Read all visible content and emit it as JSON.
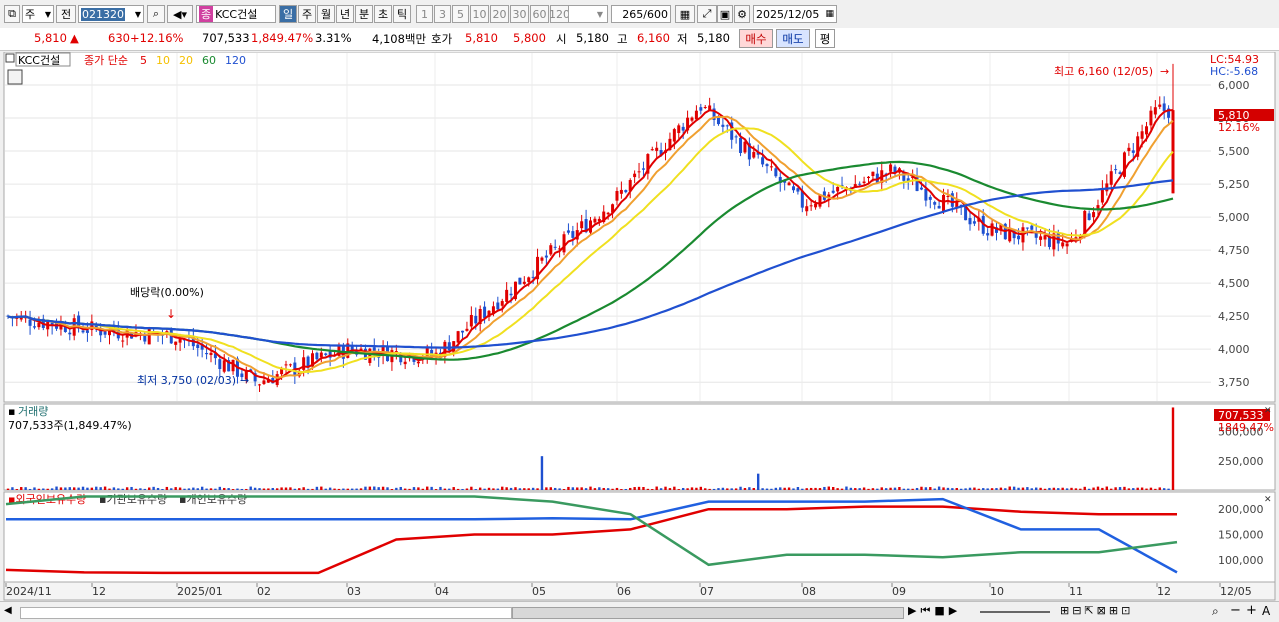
{
  "toolbar": {
    "period_selector": "주",
    "prev_label": "전",
    "stock_code": "021320",
    "stock_badge": "종",
    "stock_name": "KCC건설",
    "period_tabs": [
      "일",
      "주",
      "월",
      "년",
      "분",
      "초",
      "틱"
    ],
    "active_period": "일",
    "interval_buttons": [
      "1",
      "3",
      "5",
      "10",
      "20",
      "30",
      "60",
      "120"
    ],
    "count_value": "265",
    "count_max": "/600",
    "date": "2025/12/05"
  },
  "quote": {
    "price": "5,810",
    "arrow": "▲",
    "change": "630",
    "change_pct": "+12.16%",
    "volume": "707,533",
    "volume_pct": "1,849.47%",
    "turnover": "3.31%",
    "trade_value": "4,108백만",
    "bid_label": "호가",
    "bid_ask": "5,810",
    "bid_bid": "5,800",
    "open_label": "시",
    "open": "5,180",
    "high_label": "고",
    "high": "6,160",
    "low_label": "저",
    "low": "5,180",
    "buy_button": "매수",
    "sell_button": "매도",
    "eval_button": "평"
  },
  "price_panel": {
    "stock_label": "KCC건설",
    "ma_prefix": "종가 단순",
    "ma_periods": [
      {
        "label": "5",
        "color": "#e00000"
      },
      {
        "label": "10",
        "color": "#f5c000"
      },
      {
        "label": "20",
        "color": "#f5c000"
      },
      {
        "label": "60",
        "color": "#1a8a30"
      },
      {
        "label": "120",
        "color": "#2050d0"
      }
    ],
    "lc_label": "LC:54.93",
    "hc_label": "HC:-5.68",
    "last_price_tag": "5,810",
    "last_pct_tag": "12.16%",
    "annotation_high": "최고 6,160 (12/05)",
    "annotation_low": "최저 3,750 (02/03)",
    "annotation_dividend": "배당락(0.00%)"
  },
  "volume_panel": {
    "title": "거래량",
    "subtitle": "707,533주(1,849.47%)",
    "last_tag": "707,533",
    "last_pct_tag": "1849.47%"
  },
  "holdings_panel": {
    "series_labels": [
      "외국인보유수량",
      "기관보유수량",
      "개인보유수량"
    ]
  },
  "x_axis_labels": [
    "2024/11",
    "12",
    "2025/01",
    "02",
    "03",
    "04",
    "05",
    "06",
    "07",
    "08",
    "09",
    "10",
    "11",
    "12",
    "12/05"
  ],
  "colors": {
    "up": "#e00000",
    "down": "#1e50d0",
    "ma5": "#e00000",
    "ma10": "#f0a030",
    "ma20": "#f0e020",
    "ma60": "#1a8a30",
    "ma120": "#2050d0",
    "foreign": "#e00000",
    "institution": "#2060e0",
    "individual": "#3a9a60"
  },
  "chart_data": [
    {
      "type": "candlestick",
      "title": "KCC건설",
      "y_ticks": [
        3750,
        4000,
        4250,
        4500,
        4750,
        5000,
        5250,
        5500,
        5750,
        6000
      ],
      "ylim": [
        3600,
        6250
      ],
      "x_months": [
        "2024/11",
        "12",
        "2025/01",
        "02",
        "03",
        "04",
        "05",
        "06",
        "07",
        "08",
        "09",
        "10",
        "11",
        "12"
      ],
      "key_points": [
        {
          "date": "2024/11",
          "close": 4250
        },
        {
          "date": "2024/12",
          "close": 4150
        },
        {
          "date": "2025/01",
          "close": 4100
        },
        {
          "date": "2025/02/03",
          "low": 3750
        },
        {
          "date": "2025/03",
          "close": 4000
        },
        {
          "date": "2025/04",
          "close": 3950
        },
        {
          "date": "2025/05",
          "close": 4600
        },
        {
          "date": "2025/06",
          "close": 5150
        },
        {
          "date": "2025/07",
          "close": 5850
        },
        {
          "date": "2025/08",
          "close": 5100
        },
        {
          "date": "2025/09",
          "close": 5350
        },
        {
          "date": "2025/10",
          "close": 4900
        },
        {
          "date": "2025/11",
          "close": 4800
        },
        {
          "date": "2025/12/05",
          "open": 5180,
          "high": 6160,
          "low": 5180,
          "close": 5810
        }
      ],
      "series": [
        {
          "name": "5",
          "values": [
            4250,
            4120,
            4140,
            4120,
            3800,
            3990,
            4000,
            3960,
            4400,
            4600,
            5100,
            5900,
            5100,
            5350,
            4950,
            4780,
            5150
          ]
        },
        {
          "name": "60",
          "values": [
            4230,
            4200,
            4130,
            4030,
            3950,
            3960,
            3980,
            4000,
            4150,
            4500,
            4950,
            5200,
            5280,
            5180,
            5080,
            5000,
            5020
          ]
        },
        {
          "name": "120",
          "values": [
            4470,
            4400,
            4360,
            4300,
            4200,
            4100,
            4050,
            4050,
            4150,
            4350,
            4550,
            4750,
            4900,
            5050,
            5150,
            5140,
            5130
          ]
        }
      ]
    },
    {
      "type": "bar",
      "title": "거래량",
      "y_ticks": [
        250000,
        500000
      ],
      "ylim": [
        0,
        720000
      ],
      "spikes": [
        {
          "date": "2025/04",
          "value": 290000
        },
        {
          "date": "2025/07",
          "value": 140000
        },
        {
          "date": "2025/12/05",
          "value": 707533
        }
      ]
    },
    {
      "type": "line",
      "title": "보유수량",
      "y_ticks": [
        100000,
        150000,
        200000
      ],
      "ylim": [
        60000,
        230000
      ],
      "series": [
        {
          "name": "외국인보유수량",
          "values": [
            80000,
            75000,
            74000,
            74000,
            74000,
            140000,
            150000,
            150000,
            160000,
            200000,
            200000,
            205000,
            205000,
            195000,
            190000,
            190000
          ]
        },
        {
          "name": "기관보유수량",
          "values": [
            180000,
            180000,
            180000,
            180000,
            180000,
            180000,
            180000,
            182000,
            180000,
            215000,
            215000,
            215000,
            220000,
            160000,
            160000,
            75000
          ]
        },
        {
          "name": "개인보유수량",
          "values": [
            210000,
            225000,
            225000,
            225000,
            225000,
            225000,
            225000,
            215000,
            190000,
            90000,
            110000,
            110000,
            105000,
            115000,
            115000,
            135000
          ]
        }
      ]
    }
  ]
}
